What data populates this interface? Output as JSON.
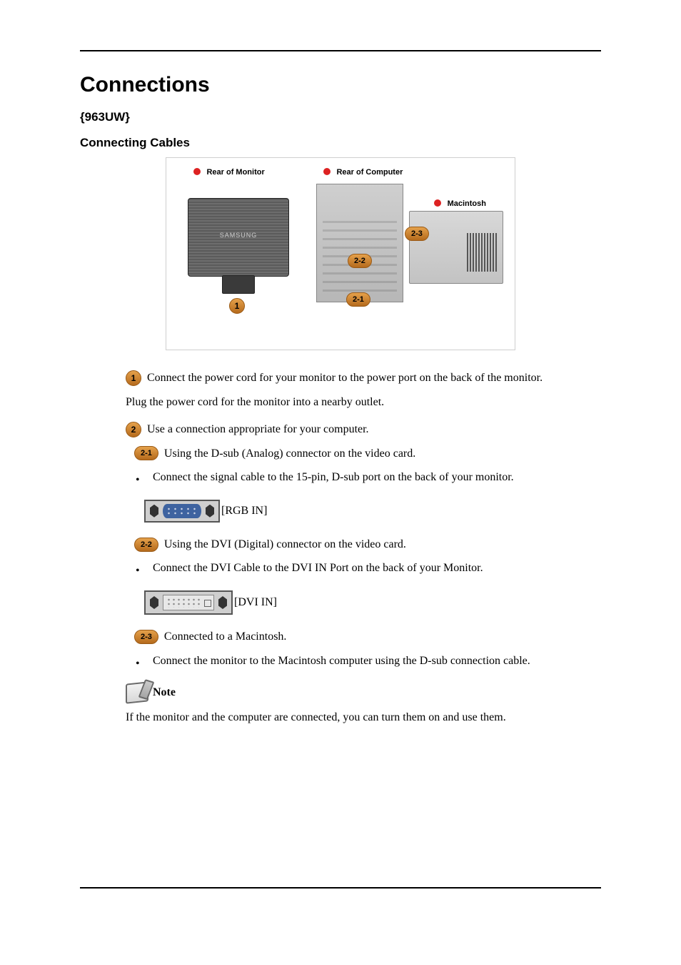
{
  "title": "Connections",
  "model": "{963UW}",
  "sectionHeading": "Connecting Cables",
  "diagram": {
    "rearOfMonitorLabel": "Rear of Monitor",
    "rearOfComputerLabel": "Rear of Computer",
    "macintoshLabel": "Macintosh",
    "monitorLogo": "SAMSUNG",
    "callouts": {
      "c1": "1",
      "c21": "2-1",
      "c22": "2-2",
      "c23": "2-3"
    }
  },
  "steps": {
    "s1_num": "1",
    "s1_text": "Connect the power cord for your monitor to the power port on the back of the monitor.",
    "s1_plug": "Plug the power cord for the monitor into a nearby outlet.",
    "s2_num": "2",
    "s2_text": "Use a connection appropriate for your computer.",
    "s21_num": "2-1",
    "s21_text": "Using the D-sub (Analog) connector on the video card.",
    "s21_bullet": "Connect the signal cable to the 15-pin, D-sub port on the back of your monitor.",
    "s21_port": "[RGB IN]",
    "s22_num": "2-2",
    "s22_text": "Using the DVI (Digital) connector on the video card.",
    "s22_bullet": "Connect the DVI Cable to the DVI IN Port on the back of your Monitor.",
    "s22_port": "[DVI IN]",
    "s23_num": "2-3",
    "s23_text": "Connected to a Macintosh.",
    "s23_bullet": "Connect the monitor to the Macintosh computer using the D-sub connection cable."
  },
  "note": {
    "label": "Note",
    "text": "If the monitor and the computer are connected, you can turn them on and use them."
  }
}
